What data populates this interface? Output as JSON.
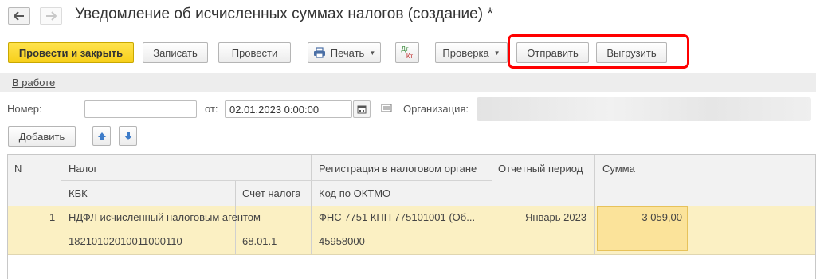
{
  "header": {
    "title": "Уведомление об исчисленных суммах налогов (создание) *",
    "back_icon": "arrow-left-icon",
    "forward_icon": "arrow-right-icon"
  },
  "toolbar": {
    "post_close_label": "Провести и закрыть",
    "save_label": "Записать",
    "post_label": "Провести",
    "print_label": "Печать",
    "dtkt_dt": "Дт",
    "dtkt_kt": "Кт",
    "check_label": "Проверка",
    "send_label": "Отправить",
    "export_label": "Выгрузить",
    "highlight_color": "#ff0000",
    "primary_color": "#f9d629"
  },
  "status": {
    "link": "В работе"
  },
  "form": {
    "number_label": "Номер:",
    "number_value": "",
    "date_label": "от:",
    "date_value": "02.01.2023  0:00:00",
    "org_label": "Организация:"
  },
  "table_toolbar": {
    "add_label": "Добавить"
  },
  "table": {
    "headers": {
      "n": "N",
      "tax": "Налог",
      "kbk": "КБК",
      "account": "Счет налога",
      "registration": "Регистрация в налоговом органе",
      "oktmo": "Код по ОКТМО",
      "period": "Отчетный период",
      "sum": "Сумма"
    },
    "rows": [
      {
        "n": "1",
        "tax": "НДФЛ исчисленный налоговым агентом",
        "kbk": "18210102010011000110",
        "account": "68.01.1",
        "registration": "ФНС 7751 КПП 775101001 (Об...",
        "oktmo": "45958000",
        "period": "Январь 2023",
        "sum": "3 059,00"
      }
    ]
  }
}
